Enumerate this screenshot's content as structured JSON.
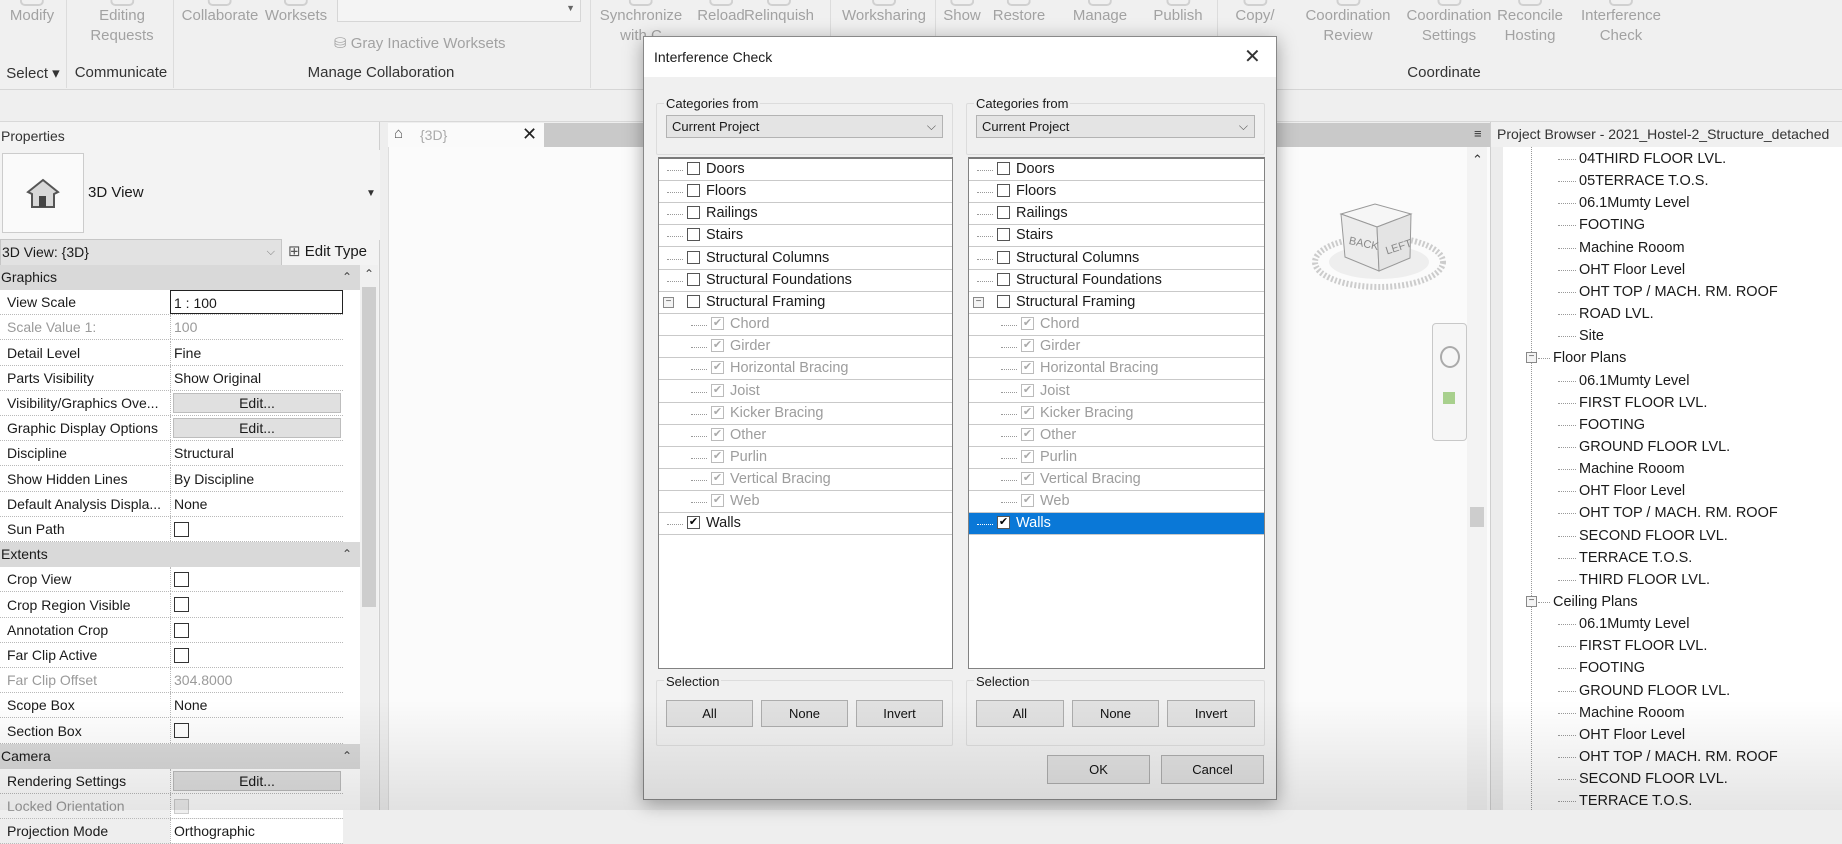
{
  "ribbon": {
    "items": [
      {
        "label": "Modify",
        "label2": ""
      },
      {
        "label": "Editing",
        "label2": "Requests"
      },
      {
        "label": "Collaborate",
        "label2": ""
      },
      {
        "label": "Worksets",
        "label2": ""
      },
      {
        "label": "Synchronize",
        "label2": "with C"
      },
      {
        "label": "Reload",
        "label2": ""
      },
      {
        "label": "Relinquish",
        "label2": ""
      },
      {
        "label": "Worksharing",
        "label2": ""
      },
      {
        "label": "Show",
        "label2": ""
      },
      {
        "label": "Restore",
        "label2": ""
      },
      {
        "label": "Manage",
        "label2": ""
      },
      {
        "label": "Publish",
        "label2": ""
      },
      {
        "label": "Copy/",
        "label2": ""
      },
      {
        "label": "Coordination",
        "label2": "Review"
      },
      {
        "label": "Coordination",
        "label2": "Settings"
      },
      {
        "label": "Reconcile",
        "label2": "Hosting"
      },
      {
        "label": "Interference",
        "label2": "Check"
      }
    ],
    "gray_inactive": "Gray Inactive Worksets",
    "panels": [
      "Select ▾",
      "Communicate",
      "Manage Collaboration",
      "Coordinate"
    ]
  },
  "properties": {
    "title": "Properties",
    "type_name": "3D View",
    "instance_selector": "3D View: {3D}",
    "edit_type": "Edit Type",
    "rows": [
      {
        "kind": "header",
        "name": "Graphics"
      },
      {
        "kind": "field",
        "name": "View Scale",
        "value": "1 : 100"
      },
      {
        "kind": "text",
        "name": "Scale Value    1:",
        "value": "100",
        "disabled": true
      },
      {
        "kind": "text",
        "name": "Detail Level",
        "value": "Fine"
      },
      {
        "kind": "text",
        "name": "Parts Visibility",
        "value": "Show Original"
      },
      {
        "kind": "button",
        "name": "Visibility/Graphics Ove...",
        "value": "Edit..."
      },
      {
        "kind": "button",
        "name": "Graphic Display Options",
        "value": "Edit..."
      },
      {
        "kind": "text",
        "name": "Discipline",
        "value": "Structural"
      },
      {
        "kind": "text",
        "name": "Show Hidden Lines",
        "value": "By Discipline"
      },
      {
        "kind": "text",
        "name": "Default Analysis Displa...",
        "value": "None"
      },
      {
        "kind": "check",
        "name": "Sun Path",
        "checked": false
      },
      {
        "kind": "header",
        "name": "Extents"
      },
      {
        "kind": "check",
        "name": "Crop View",
        "checked": false
      },
      {
        "kind": "check",
        "name": "Crop Region Visible",
        "checked": false
      },
      {
        "kind": "check",
        "name": "Annotation Crop",
        "checked": false
      },
      {
        "kind": "check",
        "name": "Far Clip Active",
        "checked": false
      },
      {
        "kind": "text",
        "name": "Far Clip Offset",
        "value": "304.8000",
        "disabled": true
      },
      {
        "kind": "text",
        "name": "Scope Box",
        "value": "None"
      },
      {
        "kind": "check",
        "name": "Section Box",
        "checked": false
      },
      {
        "kind": "header",
        "name": "Camera"
      },
      {
        "kind": "button",
        "name": "Rendering Settings",
        "value": "Edit..."
      },
      {
        "kind": "check",
        "name": "Locked Orientation",
        "checked": false,
        "disabled": true
      },
      {
        "kind": "text",
        "name": "Projection Mode",
        "value": "Orthographic"
      }
    ]
  },
  "view": {
    "tab_label": "{3D}",
    "viewcube": {
      "left": "LEFT",
      "back": "BACK"
    }
  },
  "browser": {
    "title": "Project Browser - 2021_Hostel-2_Structure_detached",
    "items": [
      {
        "level": 1,
        "label": "04THIRD FLOOR LVL."
      },
      {
        "level": 1,
        "label": "05TERRACE T.O.S."
      },
      {
        "level": 1,
        "label": "06.1Mumty Level"
      },
      {
        "level": 1,
        "label": "FOOTING"
      },
      {
        "level": 1,
        "label": "Machine Rooom"
      },
      {
        "level": 1,
        "label": "OHT Floor Level"
      },
      {
        "level": 1,
        "label": "OHT TOP / MACH. RM. ROOF"
      },
      {
        "level": 1,
        "label": "ROAD LVL."
      },
      {
        "level": 1,
        "label": "Site"
      },
      {
        "level": 0,
        "label": "Floor Plans"
      },
      {
        "level": 1,
        "label": "06.1Mumty Level"
      },
      {
        "level": 1,
        "label": "FIRST FLOOR LVL."
      },
      {
        "level": 1,
        "label": "FOOTING"
      },
      {
        "level": 1,
        "label": "GROUND FLOOR LVL."
      },
      {
        "level": 1,
        "label": "Machine Rooom"
      },
      {
        "level": 1,
        "label": "OHT Floor Level"
      },
      {
        "level": 1,
        "label": "OHT TOP / MACH. RM. ROOF"
      },
      {
        "level": 1,
        "label": "SECOND FLOOR LVL."
      },
      {
        "level": 1,
        "label": "TERRACE T.O.S."
      },
      {
        "level": 1,
        "label": "THIRD FLOOR LVL."
      },
      {
        "level": 0,
        "label": "Ceiling Plans"
      },
      {
        "level": 1,
        "label": "06.1Mumty Level"
      },
      {
        "level": 1,
        "label": "FIRST FLOOR LVL."
      },
      {
        "level": 1,
        "label": "FOOTING"
      },
      {
        "level": 1,
        "label": "GROUND FLOOR LVL."
      },
      {
        "level": 1,
        "label": "Machine Rooom"
      },
      {
        "level": 1,
        "label": "OHT Floor Level"
      },
      {
        "level": 1,
        "label": "OHT TOP / MACH. RM. ROOF"
      },
      {
        "level": 1,
        "label": "SECOND FLOOR LVL."
      },
      {
        "level": 1,
        "label": "TERRACE T.O.S."
      }
    ]
  },
  "dialog": {
    "title": "Interference Check",
    "close": "✕",
    "left": {
      "categories_from_label": "Categories from",
      "categories_from_value": "Current Project",
      "selected_index": -1
    },
    "right": {
      "categories_from_label": "Categories from",
      "categories_from_value": "Current Project",
      "selected_index": 16
    },
    "categories": [
      {
        "level": 0,
        "label": "Doors",
        "checked": false
      },
      {
        "level": 0,
        "label": "Floors",
        "checked": false
      },
      {
        "level": 0,
        "label": "Railings",
        "checked": false
      },
      {
        "level": 0,
        "label": "Stairs",
        "checked": false
      },
      {
        "level": 0,
        "label": "Structural Columns",
        "checked": false
      },
      {
        "level": 0,
        "label": "Structural Foundations",
        "checked": false
      },
      {
        "level": 0,
        "label": "Structural Framing",
        "checked": false,
        "expanded": true
      },
      {
        "level": 1,
        "label": "Chord",
        "checked": true,
        "disabled": true
      },
      {
        "level": 1,
        "label": "Girder",
        "checked": true,
        "disabled": true
      },
      {
        "level": 1,
        "label": "Horizontal Bracing",
        "checked": true,
        "disabled": true
      },
      {
        "level": 1,
        "label": "Joist",
        "checked": true,
        "disabled": true
      },
      {
        "level": 1,
        "label": "Kicker Bracing",
        "checked": true,
        "disabled": true
      },
      {
        "level": 1,
        "label": "Other",
        "checked": true,
        "disabled": true
      },
      {
        "level": 1,
        "label": "Purlin",
        "checked": true,
        "disabled": true
      },
      {
        "level": 1,
        "label": "Vertical Bracing",
        "checked": true,
        "disabled": true
      },
      {
        "level": 1,
        "label": "Web",
        "checked": true,
        "disabled": true
      },
      {
        "level": 0,
        "label": "Walls",
        "checked": true
      }
    ],
    "selection_label": "Selection",
    "sel_buttons": [
      "All",
      "None",
      "Invert"
    ],
    "ok": "OK",
    "cancel": "Cancel",
    "selected_color": "#0a78d7"
  }
}
